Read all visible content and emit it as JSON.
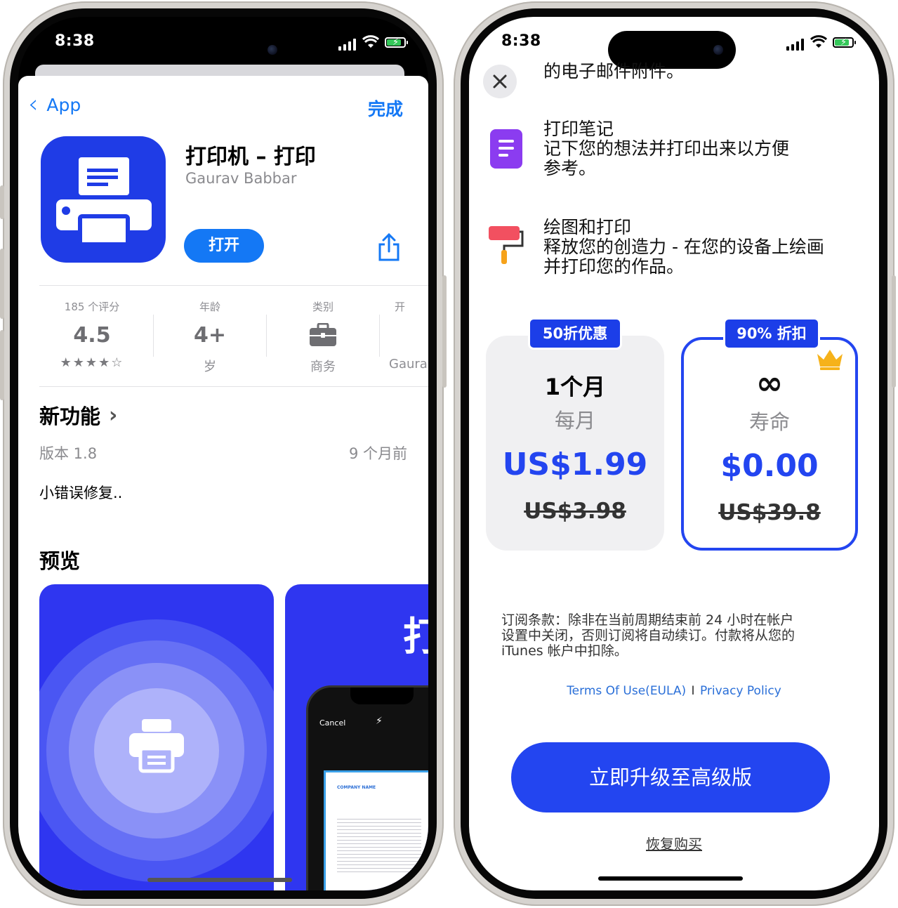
{
  "left_phone": {
    "status": {
      "time": "8:38"
    },
    "nav": {
      "back_label": "App",
      "done_label": "完成"
    },
    "app": {
      "name": "打印机 – 打印",
      "developer": "Gaurav Babbar",
      "open_button": "打开"
    },
    "stats": [
      {
        "label": "185 个评分",
        "value": "4.5",
        "sub": "★★★★☆",
        "rating": 4.5
      },
      {
        "label": "年龄",
        "value": "4+",
        "sub": "岁"
      },
      {
        "label": "类别",
        "icon": "briefcase-icon",
        "sub": "商务"
      },
      {
        "label": "开",
        "sub": "Gaura"
      }
    ],
    "whats_new": {
      "title": "新功能",
      "version": "版本 1.8",
      "date": "9 个月前",
      "notes": "小错误修复.."
    },
    "preview": {
      "title": "预览",
      "phone_cancel": "Cancel",
      "big_char": "打",
      "doc_company": "COMPANY NAME"
    },
    "colors": {
      "accent": "#1478f5",
      "app_icon": "#1f3ce6",
      "preview_bg": "#2f36f0"
    }
  },
  "right_phone": {
    "status": {
      "time": "8:38"
    },
    "features": [
      {
        "icon": "email-icon",
        "title": "的电子邮件附件。"
      },
      {
        "icon": "note-icon",
        "title": "打印笔记",
        "desc1": "记下您的想法并打印出来以方便",
        "desc2": "参考。"
      },
      {
        "icon": "paint-roller-icon",
        "title": "绘图和打印",
        "desc1": "释放您的创造力 - 在您的设备上绘画",
        "desc2": "并打印您的作品。"
      }
    ],
    "plans": [
      {
        "badge": "50折优惠",
        "name": "1个月",
        "period": "每月",
        "price": "US$1.99",
        "original": "US$3.98",
        "selected": false
      },
      {
        "badge": "90% 折扣",
        "name": "∞",
        "period": "寿命",
        "price": "$0.00",
        "original": "US$39.8",
        "selected": true,
        "icon": "crown-icon"
      }
    ],
    "terms": {
      "line1": "订阅条款：除非在当前周期结束前 24 小时在帐户",
      "line2": "设置中关闭，否则订阅将自动续订。付款将从您的",
      "line3": "iTunes 帐户中扣除。"
    },
    "links": {
      "eula": "Terms Of Use(EULA)",
      "separator": "I",
      "privacy": "Privacy Policy"
    },
    "cta": "立即升级至高级版",
    "restore": "恢复购买",
    "colors": {
      "primary": "#2345f0",
      "note_icon": "#8b3cf0",
      "roller_icon": "#f25060",
      "crown": "#f6b21a"
    }
  }
}
